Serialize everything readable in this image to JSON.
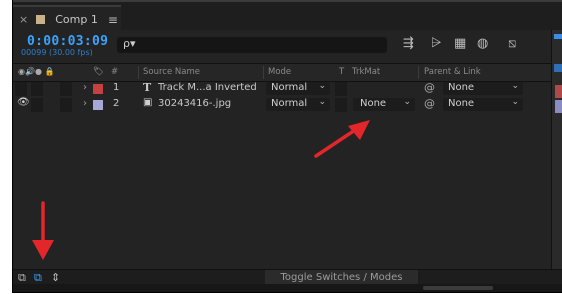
{
  "tab": {
    "close": "×",
    "title": "Comp 1",
    "menu": "≡"
  },
  "timecode": {
    "value": "0:00:03:09",
    "frames": "00099 (30.00 fps)"
  },
  "search": {
    "glyph": "ρ▾"
  },
  "toolbar_icons": [
    "comp-flowchart-icon",
    "shy-layers-icon",
    "frame-blending-icon",
    "motion-blur-icon",
    "graph-editor-icon"
  ],
  "header": {
    "av_switch_glyphs": "◉🔊● 🔒",
    "label_glyph": "🏷",
    "number": "#",
    "source_name": "Source Name",
    "mode": "Mode",
    "t": "T",
    "trkmat": "TrkMat",
    "parent": "Parent & Link"
  },
  "layers": [
    {
      "number": "1",
      "type_glyph": "T",
      "name": "Track M...a Inverted",
      "mode": "Normal",
      "trkmat": "",
      "parent": "None",
      "color": "#c54141",
      "visible": false
    },
    {
      "number": "2",
      "type_glyph": "▣",
      "name": "30243416-.jpg",
      "mode": "Normal",
      "trkmat": "None",
      "parent": "None",
      "color": "#a7a7d8",
      "visible": true
    }
  ],
  "bottom": {
    "toggle_label": "Toggle Switches / Modes"
  },
  "colors": {
    "accent": "#3aa3ff",
    "arrow": "#e3262a"
  }
}
